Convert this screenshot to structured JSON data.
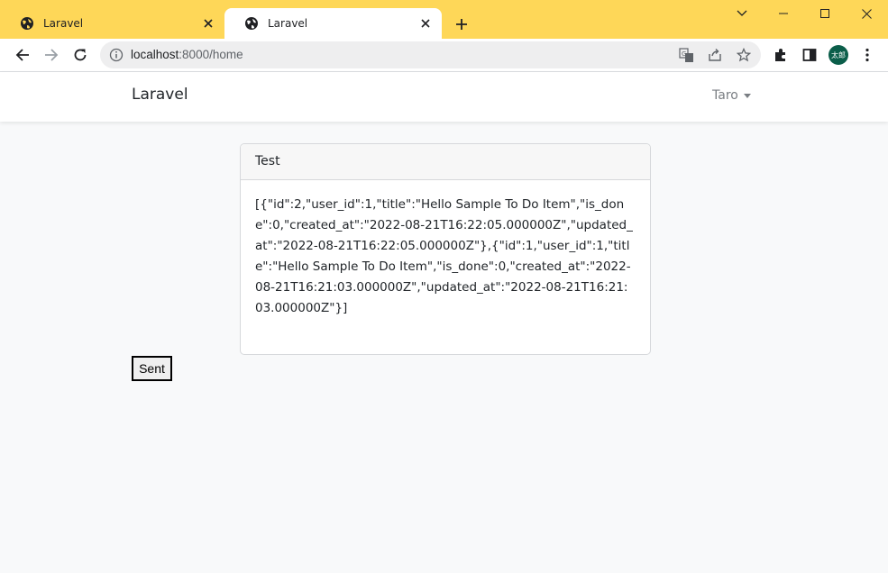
{
  "browser": {
    "tabs": [
      {
        "title": "Laravel",
        "active": false
      },
      {
        "title": "Laravel",
        "active": true
      }
    ],
    "url_host": "localhost",
    "url_rest": ":8000/home",
    "avatar_text": "太郎",
    "colors": {
      "tabstrip": "#fed758",
      "avatar": "#0b5e4a"
    }
  },
  "navbar": {
    "brand": "Laravel",
    "user": "Taro"
  },
  "card": {
    "header": "Test",
    "body": "[{\"id\":2,\"user_id\":1,\"title\":\"Hello Sample To Do Item\",\"is_done\":0,\"created_at\":\"2022-08-21T16:22:05.000000Z\",\"updated_at\":\"2022-08-21T16:22:05.000000Z\"},{\"id\":1,\"user_id\":1,\"title\":\"Hello Sample To Do Item\",\"is_done\":0,\"created_at\":\"2022-08-21T16:21:03.000000Z\",\"updated_at\":\"2022-08-21T16:21:03.000000Z\"}]"
  },
  "sent_button": {
    "label": "Sent"
  },
  "icons": [
    "globe-icon",
    "close-icon",
    "plus-icon",
    "minimize-icon",
    "maximize-icon",
    "window-close-icon",
    "back-icon",
    "forward-icon",
    "reload-icon",
    "info-icon",
    "translate-icon",
    "share-icon",
    "star-icon",
    "extensions-icon",
    "side-panel-icon",
    "menu-icon"
  ]
}
